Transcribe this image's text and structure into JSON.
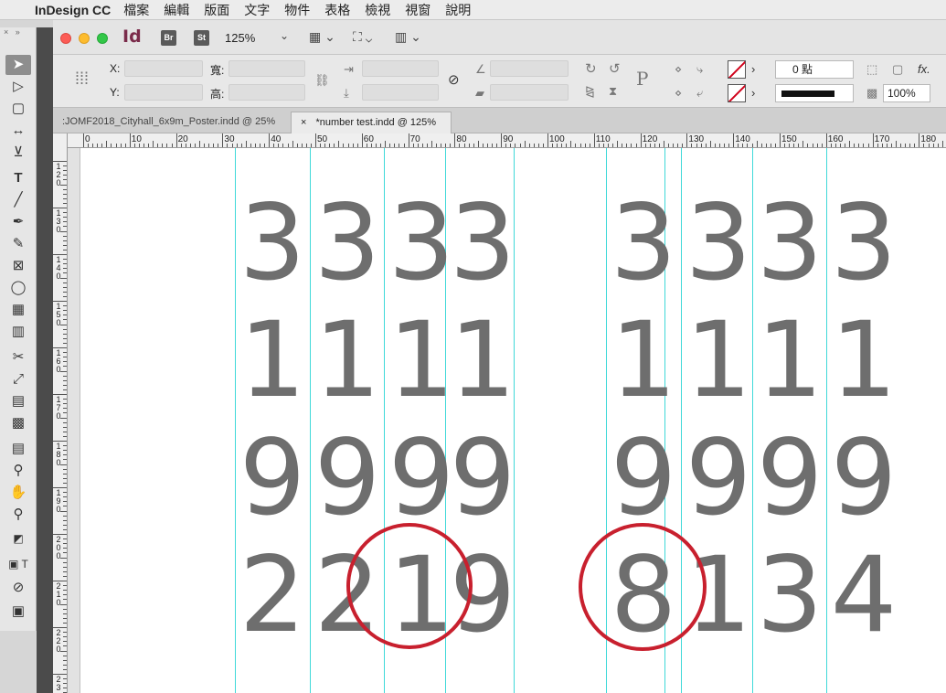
{
  "menubar": {
    "apple": "",
    "app_name": "InDesign CC",
    "items": [
      "檔案",
      "編輯",
      "版面",
      "文字",
      "物件",
      "表格",
      "檢視",
      "視窗",
      "說明"
    ]
  },
  "titlebar": {
    "app_logo": "Id",
    "bridge_label": "Br",
    "stock_label": "St",
    "zoom": "125%"
  },
  "control_panel": {
    "x_label": "X:",
    "y_label": "Y:",
    "w_label": "寬:",
    "h_label": "高:",
    "stroke_weight": "0 點",
    "opacity": "100%",
    "fx_label": "fx.",
    "paragraph_icon": "P"
  },
  "tabs": [
    {
      "label": ":JOMF2018_Cityhall_6x9m_Poster.indd @ 25%",
      "active": false
    },
    {
      "label": "*number test.indd @ 125%",
      "active": true,
      "close": "×"
    }
  ],
  "ruler": {
    "h_labels": [
      "0",
      "10",
      "20",
      "30",
      "40",
      "50",
      "60",
      "70",
      "80",
      "90",
      "100",
      "110",
      "120",
      "130",
      "140",
      "150",
      "160",
      "170",
      "180"
    ],
    "v_labels": [
      "1 2 0",
      "1 3 0",
      "1 4 0",
      "1 5 0",
      "1 6 0",
      "1 7 0",
      "1 8 0",
      "1 9 0",
      "2 0 0",
      "2 1 0",
      "2 2 0",
      "2 3"
    ]
  },
  "canvas": {
    "left_block": [
      [
        "3",
        "3",
        "3",
        "3"
      ],
      [
        "1",
        "1",
        "1",
        "1"
      ],
      [
        "9",
        "9",
        "9",
        "9"
      ],
      [
        "2",
        "2",
        "1",
        "9"
      ]
    ],
    "right_block": [
      [
        "3",
        "3",
        "3",
        "3"
      ],
      [
        "1",
        "1",
        "1",
        "1"
      ],
      [
        "9",
        "9",
        "9",
        "9"
      ],
      [
        "8",
        "1",
        "3",
        "4"
      ]
    ],
    "highlight_color": "#c8202e",
    "guide_color": "#3fd9d9",
    "digit_color": "#6e6e6e"
  },
  "toolbox": {
    "icons": [
      "selection-tool",
      "direct-selection-tool",
      "page-tool",
      "gap-tool",
      "content-collector-tool",
      "type-tool",
      "line-tool",
      "pen-tool",
      "pencil-tool",
      "rectangle-frame-tool",
      "ellipse-tool",
      "table-tool",
      "grid-tool",
      "scissors-tool",
      "free-transform-tool",
      "gradient-swatch-tool",
      "gradient-feather-tool",
      "note-tool",
      "eyedropper-tool",
      "hand-tool",
      "zoom-tool"
    ]
  }
}
